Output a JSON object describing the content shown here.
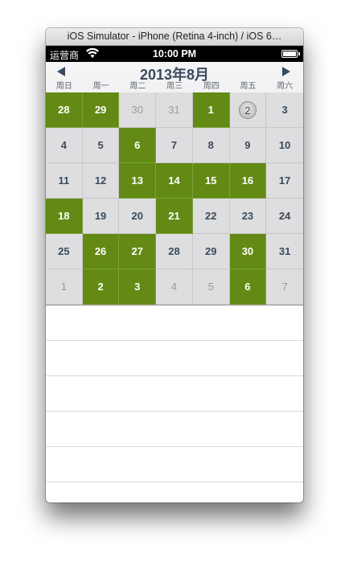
{
  "window_title": "iOS Simulator - iPhone (Retina 4-inch) / iOS 6…",
  "status_bar": {
    "carrier": "运营商",
    "time": "10:00 PM"
  },
  "calendar": {
    "title": "2013年8月",
    "weekdays": [
      "周日",
      "周一",
      "周二",
      "周三",
      "周四",
      "周五",
      "周六"
    ],
    "days": [
      {
        "d": "28",
        "state": "selected"
      },
      {
        "d": "29",
        "state": "selected"
      },
      {
        "d": "30",
        "state": "outside"
      },
      {
        "d": "31",
        "state": "outside"
      },
      {
        "d": "1",
        "state": "selected"
      },
      {
        "d": "2",
        "state": "today"
      },
      {
        "d": "3",
        "state": "normal"
      },
      {
        "d": "4",
        "state": "normal"
      },
      {
        "d": "5",
        "state": "normal"
      },
      {
        "d": "6",
        "state": "selected"
      },
      {
        "d": "7",
        "state": "normal"
      },
      {
        "d": "8",
        "state": "normal"
      },
      {
        "d": "9",
        "state": "normal"
      },
      {
        "d": "10",
        "state": "normal"
      },
      {
        "d": "11",
        "state": "normal"
      },
      {
        "d": "12",
        "state": "normal"
      },
      {
        "d": "13",
        "state": "selected"
      },
      {
        "d": "14",
        "state": "selected"
      },
      {
        "d": "15",
        "state": "selected"
      },
      {
        "d": "16",
        "state": "selected"
      },
      {
        "d": "17",
        "state": "normal"
      },
      {
        "d": "18",
        "state": "selected"
      },
      {
        "d": "19",
        "state": "normal"
      },
      {
        "d": "20",
        "state": "normal"
      },
      {
        "d": "21",
        "state": "selected"
      },
      {
        "d": "22",
        "state": "normal"
      },
      {
        "d": "23",
        "state": "normal"
      },
      {
        "d": "24",
        "state": "normal"
      },
      {
        "d": "25",
        "state": "normal"
      },
      {
        "d": "26",
        "state": "selected"
      },
      {
        "d": "27",
        "state": "selected"
      },
      {
        "d": "28",
        "state": "normal"
      },
      {
        "d": "29",
        "state": "normal"
      },
      {
        "d": "30",
        "state": "selected"
      },
      {
        "d": "31",
        "state": "normal"
      },
      {
        "d": "1",
        "state": "outside"
      },
      {
        "d": "2",
        "state": "selected"
      },
      {
        "d": "3",
        "state": "selected"
      },
      {
        "d": "4",
        "state": "outside"
      },
      {
        "d": "5",
        "state": "outside"
      },
      {
        "d": "6",
        "state": "selected"
      },
      {
        "d": "7",
        "state": "outside"
      }
    ]
  },
  "list_rows": 5,
  "colors": {
    "selected": "#628a14",
    "header_text": "#3a4a5e",
    "cell_bg": "#dedee0"
  }
}
